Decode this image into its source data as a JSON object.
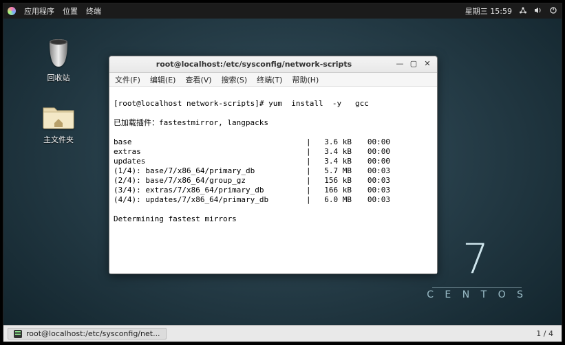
{
  "top_panel": {
    "menu_apps": "应用程序",
    "menu_places": "位置",
    "menu_terminal": "终端",
    "clock": "星期三 15:59"
  },
  "desktop": {
    "trash_label": "回收站",
    "home_label": "主文件夹"
  },
  "brand": {
    "big": "7",
    "name": "C E N T O S"
  },
  "window": {
    "title": "root@localhost:/etc/sysconfig/network-scripts",
    "menus": {
      "file": "文件(F)",
      "edit": "编辑(E)",
      "view": "查看(V)",
      "search": "搜索(S)",
      "terminal": "终端(T)",
      "help": "帮助(H)"
    }
  },
  "terminal": {
    "prompt": "[root@localhost network-scripts]# yum  install  -y   gcc",
    "line_plugins": "已加载插件：fastestmirror, langpacks",
    "rows": [
      {
        "name": "base",
        "size": "3.6 kB",
        "time": "00:00"
      },
      {
        "name": "extras",
        "size": "3.4 kB",
        "time": "00:00"
      },
      {
        "name": "updates",
        "size": "3.4 kB",
        "time": "00:00"
      },
      {
        "name": "(1/4): base/7/x86_64/primary_db",
        "size": "5.7 MB",
        "time": "00:03"
      },
      {
        "name": "(2/4): base/7/x86_64/group_gz",
        "size": "156 kB",
        "time": "00:03"
      },
      {
        "name": "(3/4): extras/7/x86_64/primary_db",
        "size": "166 kB",
        "time": "00:03"
      },
      {
        "name": "(4/4): updates/7/x86_64/primary_db",
        "size": "6.0 MB",
        "time": "00:03"
      }
    ],
    "footer": "Determining fastest mirrors"
  },
  "taskbar": {
    "item": "root@localhost:/etc/sysconfig/net...",
    "workspace": "1 / 4"
  }
}
